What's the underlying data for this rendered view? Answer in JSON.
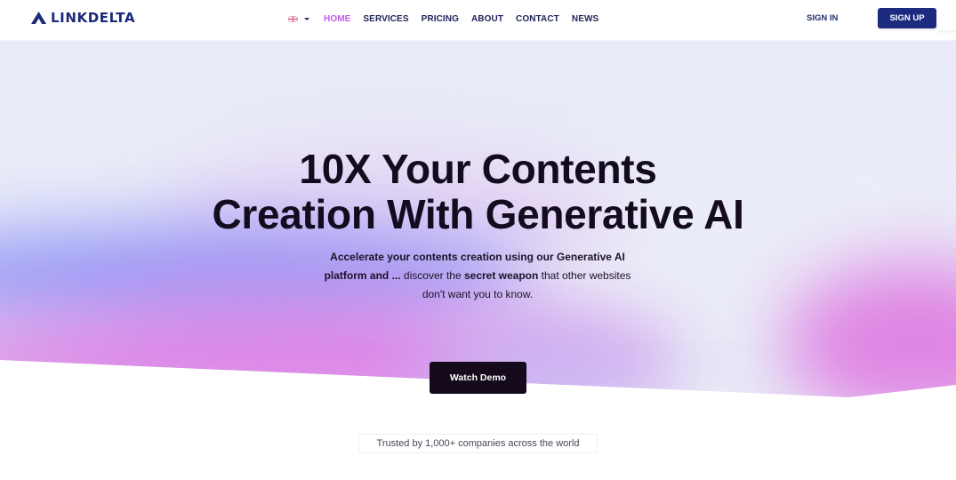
{
  "nav": {
    "logo_text": "LINKDELTA",
    "logo_icon": "delta-chevron-icon",
    "language": {
      "icon": "uk-flag-icon",
      "selected": "EN"
    },
    "items": [
      {
        "label": "HOME",
        "active": true
      },
      {
        "label": "SERVICES",
        "active": false
      },
      {
        "label": "PRICING",
        "active": false
      },
      {
        "label": "ABOUT",
        "active": false
      },
      {
        "label": "CONTACT",
        "active": false
      },
      {
        "label": "NEWS",
        "active": false
      }
    ],
    "sign_in_label": "SIGN IN",
    "sign_up_label": "SIGN UP"
  },
  "hero": {
    "headline_line1": "10X Your Contents",
    "headline_line2": "Creation With Generative AI",
    "subtext": {
      "part1_bold": "Accelerate your contents creation using our Generative AI platform and ...",
      "part2": " discover the ",
      "part3_bold": "secret weapon",
      "part4": " that other websites don't want you to know."
    },
    "cta_label": "Watch Demo",
    "trusted_text": "Trusted by 1,000+ companies across the world"
  },
  "colors": {
    "brand_navy": "#1c2a80",
    "active_nav": "#c15bea",
    "cta_dark": "#140a1c",
    "gradient_blue": "#8c8ef6",
    "gradient_pink": "#dc7ce4"
  }
}
